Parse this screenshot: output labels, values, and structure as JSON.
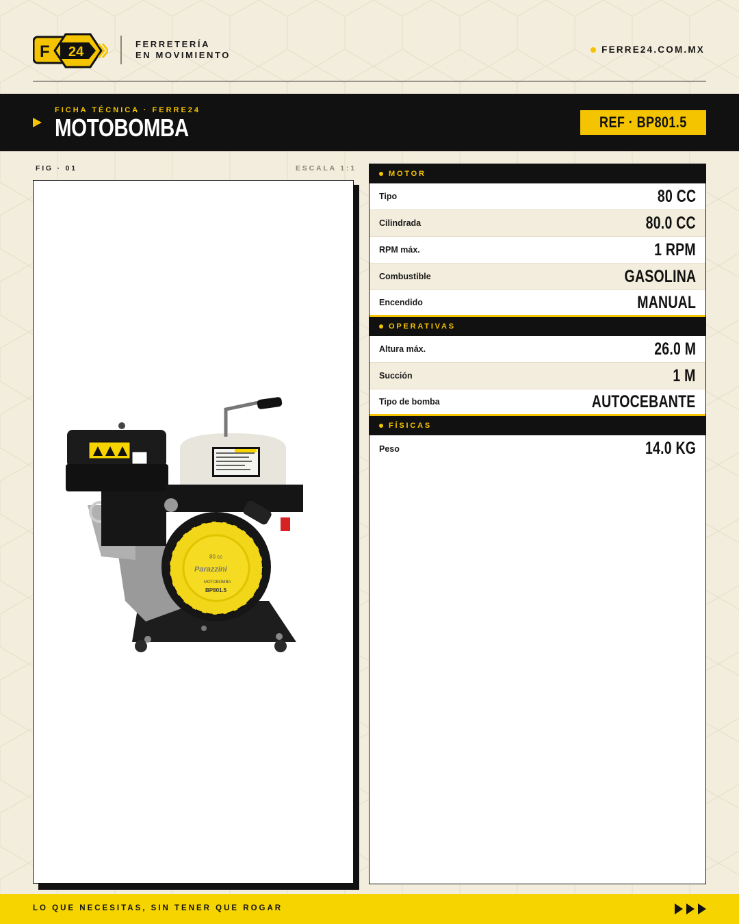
{
  "brand": {
    "logo_letter": "F",
    "logo_number": "24",
    "tagline_line1": "FERRETERÍA",
    "tagline_line2": "EN MOVIMIENTO",
    "website": "FERRE24.COM.MX"
  },
  "header": {
    "kicker": "FICHA TÉCNICA · FERRE24",
    "title": "MOTOBOMBA",
    "reference": "REF · BP801.5"
  },
  "figure": {
    "label": "FIG · 01",
    "scale": "ESCALA 1:1",
    "plate_brand": "Parazzini",
    "plate_model_name": "MOTOBOMBA",
    "plate_model": "BP801.5",
    "plate_cc": "80 cc"
  },
  "specs": {
    "motor": {
      "title": "MOTOR",
      "rows": [
        {
          "label": "Tipo",
          "value": "80 CC"
        },
        {
          "label": "Cilindrada",
          "value": "80.0 CC"
        },
        {
          "label": "RPM máx.",
          "value": "1 RPM"
        },
        {
          "label": "Combustible",
          "value": "GASOLINA"
        },
        {
          "label": "Encendido",
          "value": "MANUAL"
        }
      ]
    },
    "operativas": {
      "title": "OPERATIVAS",
      "rows": [
        {
          "label": "Altura máx.",
          "value": "26.0 M"
        },
        {
          "label": "Succión",
          "value": "1 M"
        },
        {
          "label": "Tipo de bomba",
          "value": "AUTOCEBANTE"
        }
      ]
    },
    "fisicas": {
      "title": "FÍSICAS",
      "rows": [
        {
          "label": "Peso",
          "value": "14.0 KG"
        }
      ]
    }
  },
  "footer": {
    "slogan": "LO QUE NECESITAS, SIN TENER QUE ROGAR"
  },
  "colors": {
    "accent": "#f5c400",
    "dark": "#111111",
    "background": "#f3eddd"
  },
  "icons": [
    "hexagon-logo",
    "arrow-right-icon",
    "triple-arrow-icon",
    "bullet-dot-icon"
  ]
}
